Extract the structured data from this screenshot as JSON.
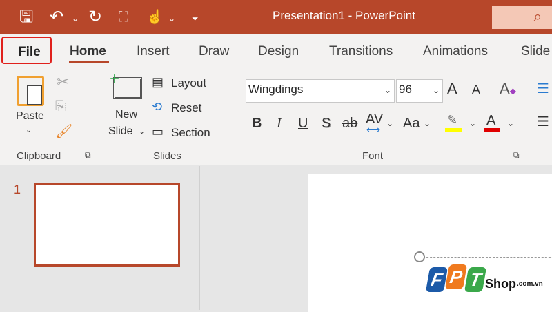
{
  "titlebar": {
    "title": "Presentation1  -  PowerPoint",
    "search_icon": "search-icon"
  },
  "quick_access": [
    "save-icon",
    "undo-icon",
    "redo-icon",
    "present-icon",
    "touch-mode-icon",
    "customize-icon"
  ],
  "tabs": [
    {
      "label": "File"
    },
    {
      "label": "Home"
    },
    {
      "label": "Insert"
    },
    {
      "label": "Draw"
    },
    {
      "label": "Design"
    },
    {
      "label": "Transitions"
    },
    {
      "label": "Animations"
    },
    {
      "label": "Slide"
    }
  ],
  "ribbon": {
    "clipboard": {
      "paste": "Paste",
      "group": "Clipboard"
    },
    "slides": {
      "new": "New",
      "slide": "Slide",
      "layout": "Layout",
      "reset": "Reset",
      "section": "Section",
      "group": "Slides"
    },
    "font": {
      "font_name": "Wingdings",
      "font_size": "96",
      "bold": "B",
      "italic": "I",
      "underline": "U",
      "shadow": "S",
      "strike": "ab",
      "spacing": "AV",
      "case": "Aa",
      "grow": "A",
      "shrink": "A",
      "color": "A",
      "group": "Font",
      "highlight_color": "#ffff00",
      "font_color": "#e00000"
    }
  },
  "slides_pane": {
    "number": "1"
  },
  "logo": {
    "text": "FPT",
    "shop": "Shop",
    "domain": ".com.vn"
  },
  "colors": {
    "accent": "#b7472a"
  }
}
